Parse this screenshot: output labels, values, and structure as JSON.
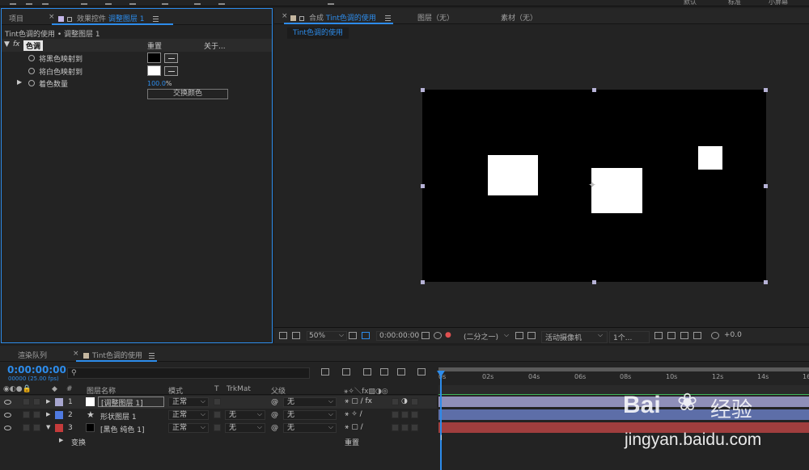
{
  "toolbar": {
    "workspaces": [
      "默认",
      "标准",
      "小屏幕"
    ]
  },
  "effect_panel": {
    "tab_project": "项目",
    "tab_prefix": "效果控件",
    "tab_layer": "调整图层 1",
    "breadcrumb_comp": "Tint色调的使用",
    "breadcrumb_sep": "•",
    "breadcrumb_layer": "调整图层 1",
    "effect_fx": "fx",
    "effect_name": "色调",
    "reset": "重置",
    "about": "关于...",
    "map_black": "将黑色映射到",
    "map_white": "将白色映射到",
    "amount_label": "着色数量",
    "amount_value": "100.0",
    "amount_unit": "%",
    "swap_button": "交换颜色",
    "black_color": "#000000",
    "white_color": "#ffffff"
  },
  "comp_panel": {
    "tab_prefix": "合成",
    "tab_name": "Tint色调的使用",
    "layer_tab": "图层（无）",
    "footage_tab": "素材（无）",
    "flow_chip": "Tint色调的使用"
  },
  "viewer_bar": {
    "zoom": "50%",
    "timecode": "0:00:00:00",
    "resolution": "(二分之一)",
    "camera": "活动摄像机",
    "views": "1个...",
    "exposure": "+0.0"
  },
  "timeline": {
    "tab_render": "渲染队列",
    "tab_comp": "Tint色调的使用",
    "timecode": "0:00:00:00",
    "frames": "00000 (25.00 fps)",
    "search_placeholder": "",
    "col_num": "#",
    "col_name": "图层名称",
    "col_mode": "模式",
    "col_t": "T",
    "col_trkmat": "TrkMat",
    "col_parent": "父级",
    "ruler_ticks": [
      "0s",
      "02s",
      "04s",
      "06s",
      "08s",
      "10s",
      "12s",
      "14s",
      "16"
    ],
    "layers": [
      {
        "num": "1",
        "name": "[调整图层 1]",
        "mode": "正常",
        "trkmat": "",
        "parent": "无",
        "label_color": "#a7a6cf",
        "bar_color": "#8f8fb8"
      },
      {
        "num": "2",
        "name": "形状图层 1",
        "mode": "正常",
        "trkmat": "无",
        "parent": "无",
        "label_color": "#4f7ae0",
        "bar_color": "#5d6ea8"
      },
      {
        "num": "3",
        "name": "[黑色 纯色 1]",
        "mode": "正常",
        "trkmat": "无",
        "parent": "无",
        "label_color": "#c43b3b",
        "bar_color": "#a03e3e"
      }
    ],
    "transform_label": "变换",
    "transform_reset": "重置"
  },
  "watermark": {
    "brand": "Bai",
    "brand_cn": "经验",
    "url": "jingyan.baidu.com"
  }
}
